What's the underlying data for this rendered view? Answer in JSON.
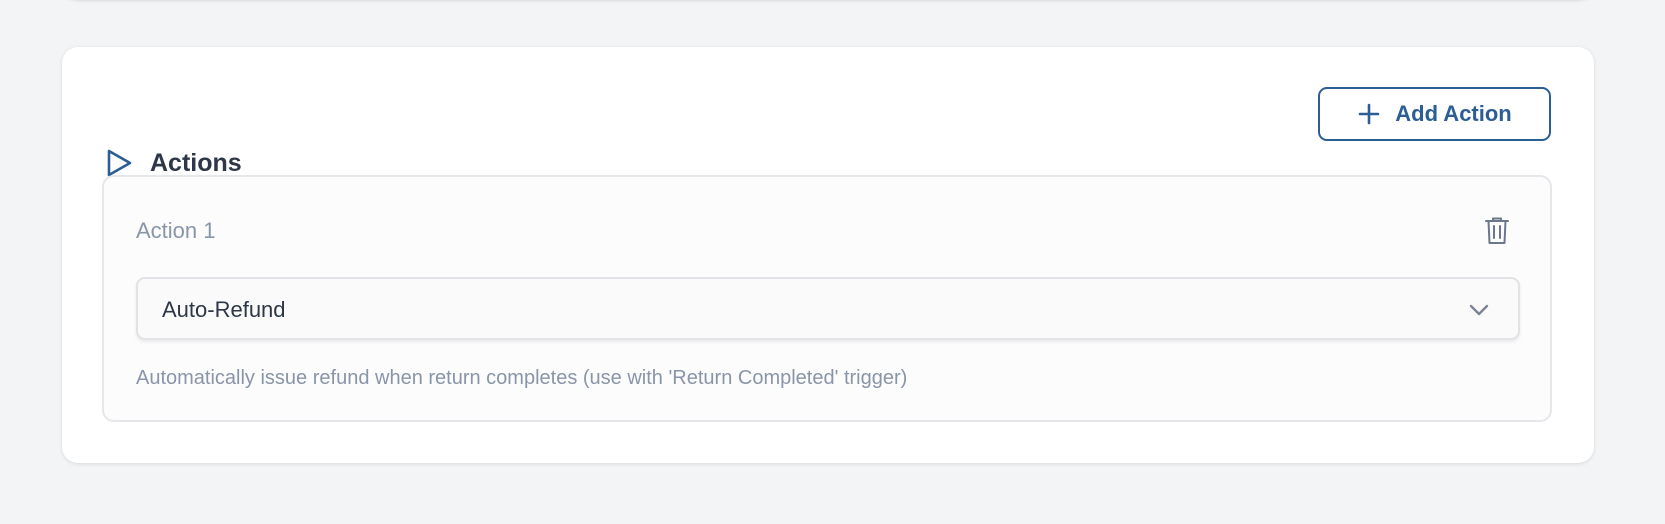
{
  "actions_card": {
    "title": "Actions",
    "title_icon": "play-icon",
    "add_button": {
      "label": "Add Action",
      "icon": "plus-icon"
    },
    "items": [
      {
        "label": "Action 1",
        "delete_icon": "trash-icon",
        "select": {
          "value": "Auto-Refund",
          "icon": "chevron-down-icon"
        },
        "description": "Automatically issue refund when return completes (use with 'Return Completed' trigger)"
      }
    ]
  },
  "colors": {
    "accent": "#2c5e96",
    "text_primary": "#2d3748",
    "text_muted": "#8995a8",
    "page_background": "#f3f4f6",
    "card_background": "#ffffff"
  }
}
